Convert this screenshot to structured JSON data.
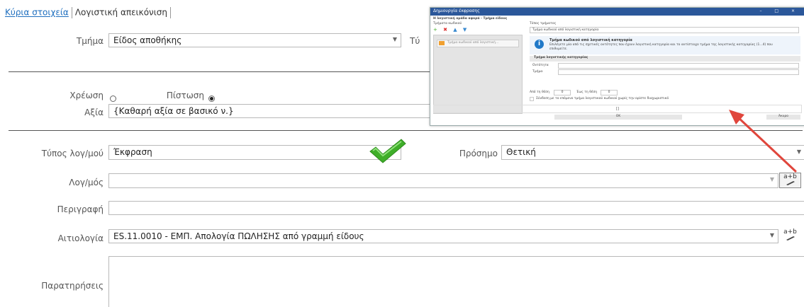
{
  "tabs": [
    {
      "label": "Κύρια στοιχεία",
      "active": true
    },
    {
      "label": "Λογιστική απεικόνιση",
      "active": false
    }
  ],
  "form": {
    "tmima_label": "Τμήμα",
    "tmima_value": "Είδος αποθήκης",
    "typos_partial_label": "Τύ",
    "xreosi_label": "Χρέωση",
    "pistosi_label": "Πίστωση",
    "selected_side": "Πίστωση",
    "axia_label": "Αξία",
    "axia_value": "{Καθαρή αξία σε βασικό ν.}",
    "typos_log_label": "Τύπος λογ/μού",
    "typos_log_value": "Έκφραση",
    "prosimo_label": "Πρόσημο",
    "prosimo_value": "Θετική",
    "logos_label": "Λογ/μός",
    "logos_value": "",
    "perigrafi_label": "Περιγραφή",
    "perigrafi_value": "",
    "aitiologia_label": "Αιτιολογία",
    "aitiologia_value": "ES.11.0010 - ΕΜΠ. Απολογία ΠΩΛΗΣΗΣ από γραμμή είδους",
    "paratiriseis_label": "Παρατηρήσεις",
    "paratiriseis_value": "",
    "formula_button": "a+b"
  },
  "dialog": {
    "title": "Δημιουργία έκφρασης",
    "subtitle": "Η λογιστική ομάδα αφορά - Τμήμα είδους",
    "left_header": "Τμήματα κωδικού",
    "left_item": "Τμήμα κωδικού από λογιστική...",
    "type_label": "Τύπος τμήματος",
    "type_value": "Τμήμα κωδικού από λογιστική κατηγορία",
    "info_title": "Τμήμα κωδικού από λογιστική κατηγορία",
    "info_text": "Επιλέγετε μία από τις σχετικές οντότητες που έχουν λογιστική κατηγορία και το αντίστοιχο τμήμα της λογιστικής κατηγορίας (1...4) που επιθυμείτε.",
    "section_title": "Τμήμα λογιστικής κατηγορίας",
    "entity_label": "Οντότητα",
    "part_label": "Τμήμα",
    "from_label": "Από τη θέση",
    "from_value": "0",
    "to_label": "Έως τη θέση",
    "to_value": "0",
    "checkbox_label": "Σύνδεση με το επόμενο τμήμα λογιστικού κωδικού χωρίς την ορίστε διαχωριστικό",
    "preview": "[]",
    "ok_label": "OK",
    "cancel_label": "Άκυρο"
  },
  "colors": {
    "tab_active": "#1f6fbf",
    "checkmark": "#3fae29",
    "arrow": "#e0463c",
    "dialog_title_bg": "#2b579a"
  }
}
